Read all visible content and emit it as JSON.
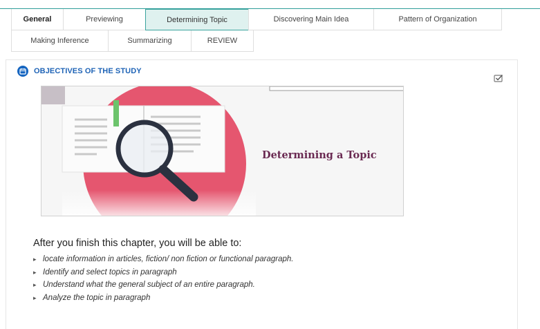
{
  "tabs": {
    "row1": [
      {
        "label": "General",
        "active": false,
        "bold": true
      },
      {
        "label": "Previewing",
        "active": false
      },
      {
        "label": "Determining Topic",
        "active": true
      },
      {
        "label": "Discovering Main Idea",
        "active": false
      },
      {
        "label": "Pattern of Organization",
        "active": false
      }
    ],
    "row2": [
      {
        "label": "Making Inference",
        "active": false
      },
      {
        "label": "Summarizing",
        "active": false
      },
      {
        "label": "REVIEW",
        "active": false
      }
    ]
  },
  "section": {
    "title": "OBJECTIVES OF THE STUDY",
    "icon": "calendar-icon",
    "completion_icon": "checkbox-icon"
  },
  "banner": {
    "text": "Determining a Topic"
  },
  "content": {
    "intro": "After you finish this chapter, you will be able to:",
    "objectives": [
      "locate information in articles, fiction/ non fiction or functional paragraph.",
      "Identify and select topics in paragraph",
      "Understand what the general subject of an entire paragraph.",
      "Analyze the topic in paragraph"
    ]
  },
  "colors": {
    "accent": "#3aa39d",
    "active_tab_bg": "#dff1ef",
    "title_blue": "#1e63b6",
    "banner_circle": "#e5566f"
  }
}
